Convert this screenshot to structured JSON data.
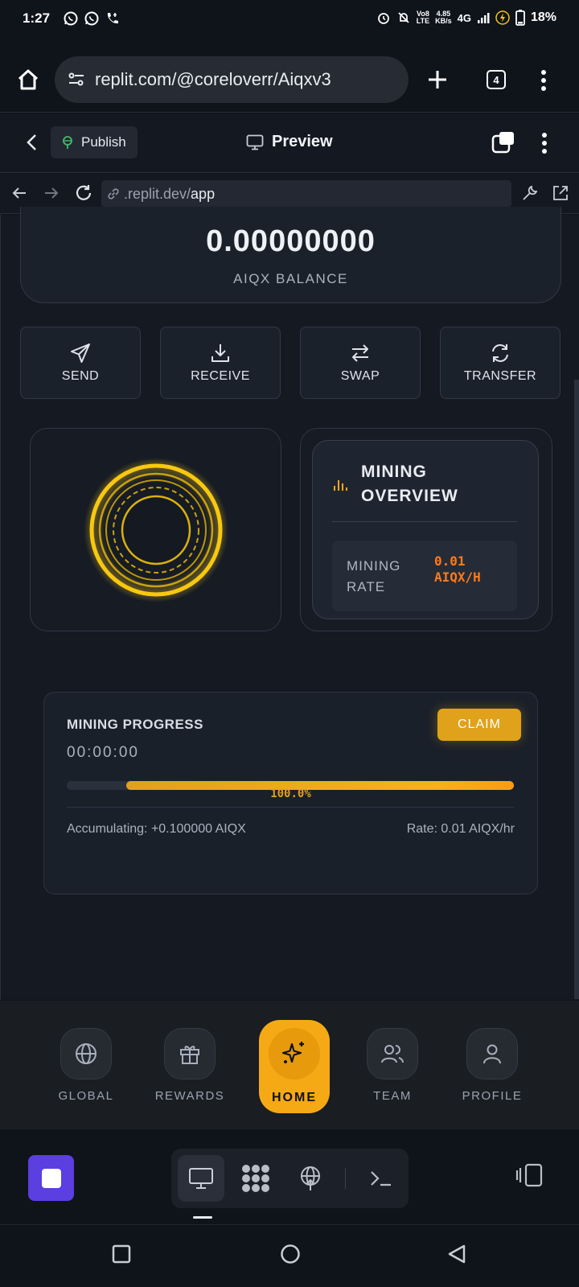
{
  "status_bar": {
    "time": "1:27",
    "net_speed_top": "4.85",
    "net_speed_bottom": "KB/s",
    "volte_top": "Vo8",
    "volte_bottom": "LTE",
    "network": "4G",
    "battery": "18%"
  },
  "browser": {
    "url": "replit.com/@coreloverr/Aiqxv3",
    "tab_count": "4"
  },
  "replit_header": {
    "publish_label": "Publish",
    "preview_label": "Preview"
  },
  "address": {
    "domain": ".replit.dev/",
    "path": "app"
  },
  "wallet": {
    "balance": "0.00000000",
    "balance_label": "AIQX BALANCE"
  },
  "actions": [
    {
      "label": "SEND",
      "icon": "send-icon"
    },
    {
      "label": "RECEIVE",
      "icon": "download-icon"
    },
    {
      "label": "SWAP",
      "icon": "swap-arrows-icon"
    },
    {
      "label": "TRANSFER",
      "icon": "refresh-icon"
    }
  ],
  "overview": {
    "title": "MINING OVERVIEW",
    "rate_label": "MINING RATE",
    "rate_value": "0.01 AIQX/H"
  },
  "progress": {
    "title": "MINING PROGRESS",
    "timer": "00:00:00",
    "claim_label": "CLAIM",
    "percent_label": "100.0%",
    "bar_start_fraction": 0.133,
    "bar_end_fraction": 1.0,
    "accumulating": "Accumulating: +0.100000 AIQX",
    "rate": "Rate: 0.01 AIQX/hr"
  },
  "bottom_nav": {
    "global": "GLOBAL",
    "rewards": "REWARDS",
    "home": "HOME",
    "team": "TEAM",
    "profile": "PROFILE"
  },
  "colors": {
    "accent": "#f5a915",
    "rate_orange": "#ff7a1a",
    "stop_button": "#5b3fe0"
  }
}
